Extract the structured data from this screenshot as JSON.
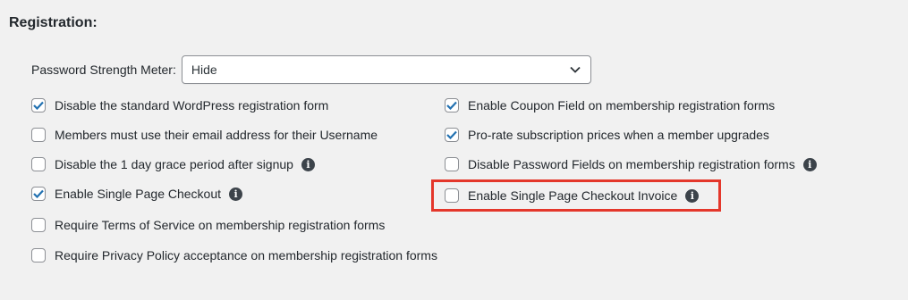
{
  "section": {
    "title": "Registration:"
  },
  "password_meter": {
    "label": "Password Strength Meter:",
    "value": "Hide"
  },
  "left_options": [
    {
      "label": "Disable the standard WordPress registration form",
      "checked": true,
      "info": false
    },
    {
      "label": "Members must use their email address for their Username",
      "checked": false,
      "info": false
    },
    {
      "label": "Disable the 1 day grace period after signup",
      "checked": false,
      "info": true
    },
    {
      "label": "Enable Single Page Checkout",
      "checked": true,
      "info": true
    },
    {
      "label": "Require Terms of Service on membership registration forms",
      "checked": false,
      "info": false
    },
    {
      "label": "Require Privacy Policy acceptance on membership registration forms",
      "checked": false,
      "info": false
    }
  ],
  "right_options": [
    {
      "label": "Enable Coupon Field on membership registration forms",
      "checked": true,
      "info": false
    },
    {
      "label": "Pro-rate subscription prices when a member upgrades",
      "checked": true,
      "info": false
    },
    {
      "label": "Disable Password Fields on membership registration forms",
      "checked": false,
      "info": true
    },
    {
      "label": "Enable Single Page Checkout Invoice",
      "checked": false,
      "info": true,
      "highlighted": true
    }
  ],
  "colors": {
    "checkmark": "#2271b1",
    "highlight": "#e4372b",
    "info_bg": "#3c434a"
  },
  "icons": {
    "info": "info-icon",
    "check": "checkmark-icon",
    "dropdown": "chevron-down-icon"
  }
}
